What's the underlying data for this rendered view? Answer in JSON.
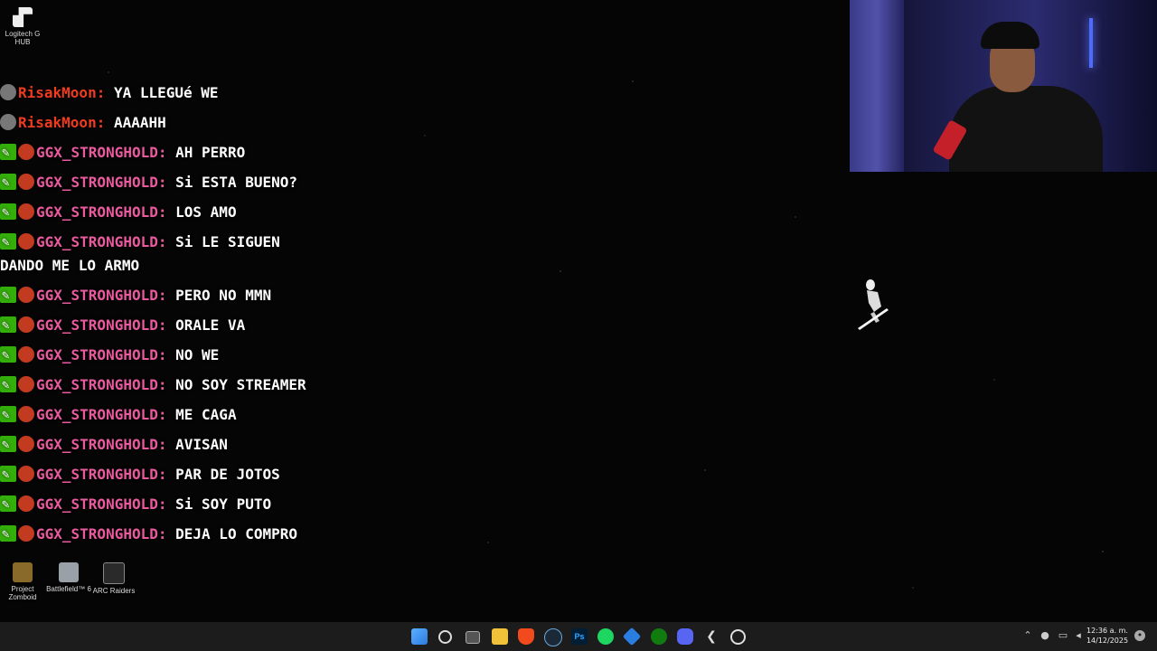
{
  "desktop": {
    "icons": [
      {
        "label": "Logitech G\nHUB",
        "icon": "logitech-icon"
      },
      {
        "label": "Project\nZomboid",
        "icon": "zomboid-icon"
      },
      {
        "label": "Battlefield™ 6",
        "icon": "battlefield-icon"
      },
      {
        "label": "ARC Raiders",
        "icon": "arc-raiders-icon"
      }
    ]
  },
  "chat": [
    {
      "user": "RisakMoon:",
      "text": "YA LLEGUé WE",
      "badges": [
        "gray"
      ],
      "color": "#ef3b20"
    },
    {
      "user": "RisakMoon:",
      "text": "AAAAHH",
      "badges": [
        "gray"
      ],
      "color": "#ef3b20"
    },
    {
      "user": "GGX_STRONGHOLD:",
      "text": "AH PERRO",
      "badges": [
        "mod",
        "face"
      ],
      "color": "#ea5a9e"
    },
    {
      "user": "GGX_STRONGHOLD:",
      "text": "Si ESTA BUENO?",
      "badges": [
        "mod",
        "face"
      ],
      "color": "#ea5a9e"
    },
    {
      "user": "GGX_STRONGHOLD:",
      "text": "LOS AMO",
      "badges": [
        "mod",
        "face"
      ],
      "color": "#ea5a9e"
    },
    {
      "user": "GGX_STRONGHOLD:",
      "text": "Si LE SIGUEN DANDO ME LO ARMO",
      "badges": [
        "mod",
        "face"
      ],
      "color": "#ea5a9e"
    },
    {
      "user": "GGX_STRONGHOLD:",
      "text": "PERO NO MMN",
      "badges": [
        "mod",
        "face"
      ],
      "color": "#ea5a9e"
    },
    {
      "user": "GGX_STRONGHOLD:",
      "text": "ORALE VA",
      "badges": [
        "mod",
        "face"
      ],
      "color": "#ea5a9e"
    },
    {
      "user": "GGX_STRONGHOLD:",
      "text": "NO WE",
      "badges": [
        "mod",
        "face"
      ],
      "color": "#ea5a9e"
    },
    {
      "user": "GGX_STRONGHOLD:",
      "text": "NO SOY STREAMER",
      "badges": [
        "mod",
        "face"
      ],
      "color": "#ea5a9e"
    },
    {
      "user": "GGX_STRONGHOLD:",
      "text": "ME CAGA",
      "badges": [
        "mod",
        "face"
      ],
      "color": "#ea5a9e"
    },
    {
      "user": "GGX_STRONGHOLD:",
      "text": "AVISAN",
      "badges": [
        "mod",
        "face"
      ],
      "color": "#ea5a9e"
    },
    {
      "user": "GGX_STRONGHOLD:",
      "text": "PAR DE JOTOS",
      "badges": [
        "mod",
        "face"
      ],
      "color": "#ea5a9e"
    },
    {
      "user": "GGX_STRONGHOLD:",
      "text": "Si SOY PUTO",
      "badges": [
        "mod",
        "face"
      ],
      "color": "#ea5a9e"
    },
    {
      "user": "GGX_STRONGHOLD:",
      "text": "DEJA LO COMPRO",
      "badges": [
        "mod",
        "face"
      ],
      "color": "#ea5a9e"
    }
  ],
  "taskbar": {
    "apps": [
      "windows-start-icon",
      "search-icon",
      "task-view-icon",
      "file-explorer-icon",
      "brave-icon",
      "steam-icon",
      "photoshop-icon",
      "spotify-icon",
      "app-icon",
      "xbox-icon",
      "discord-icon",
      "logitech-icon",
      "obs-icon"
    ],
    "photoshop_label": "Ps",
    "time": "12:36 a. m.",
    "date": "14/12/2025"
  }
}
